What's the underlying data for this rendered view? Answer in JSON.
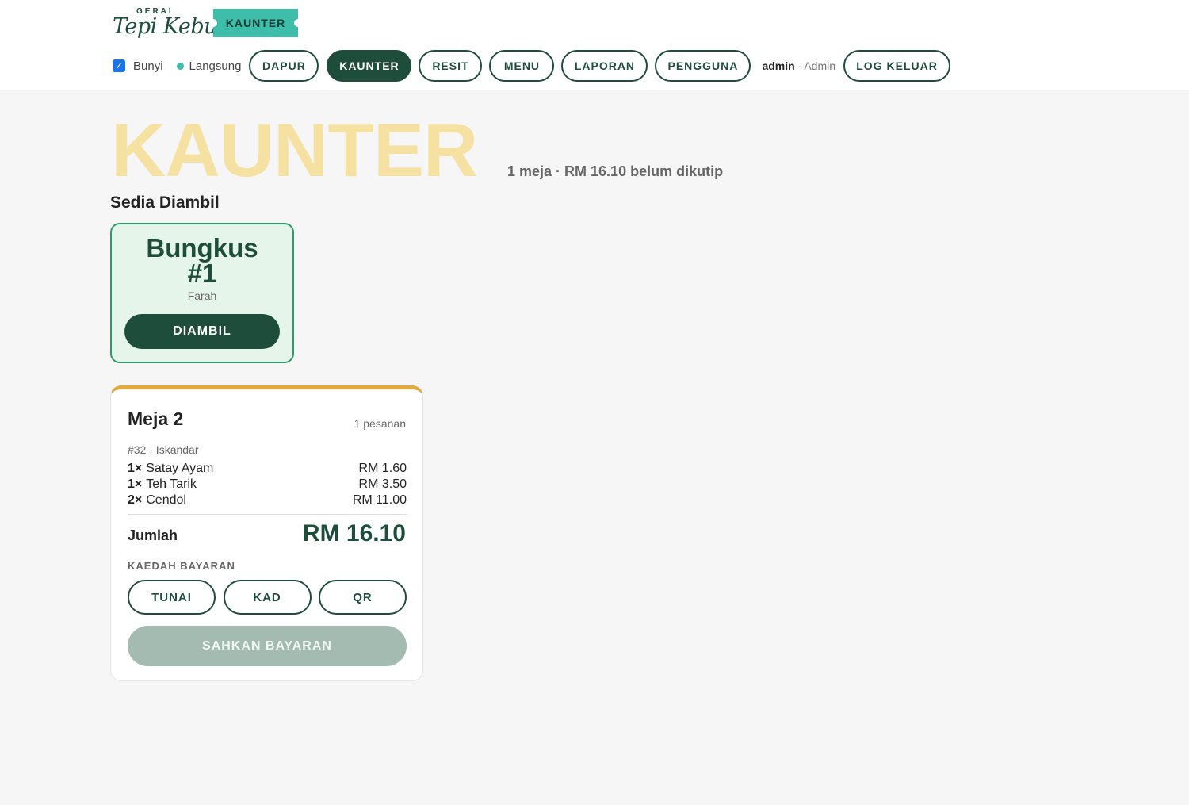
{
  "brand": {
    "small": "GERAI",
    "script": "Tepi Kebun",
    "ticket": "KAUNTER"
  },
  "nav": {
    "sound_label": "Bunyi",
    "sound_checked": true,
    "live_label": "Langsung",
    "buttons": [
      "DAPUR",
      "KAUNTER",
      "RESIT",
      "MENU",
      "LAPORAN",
      "PENGGUNA"
    ],
    "active": "KAUNTER",
    "user_name": "admin",
    "user_sep": " · ",
    "user_role": "Admin",
    "logout": "LOG KELUAR"
  },
  "page": {
    "title": "KAUNTER",
    "subtitle": "1 meja · RM 16.10 belum dikutip",
    "ready_section": "Sedia Diambil"
  },
  "ready_card": {
    "title_line1": "Bungkus",
    "title_line2": "#1",
    "name": "Farah",
    "button": "DIAMBIL"
  },
  "table_card": {
    "table": "Meja 2",
    "order_count": "1 pesanan",
    "order_meta": "#32 · Iskandar",
    "items": [
      {
        "qty": "1×",
        "name": "Satay Ayam",
        "price": "RM 1.60"
      },
      {
        "qty": "1×",
        "name": "Teh Tarik",
        "price": "RM 3.50"
      },
      {
        "qty": "2×",
        "name": "Cendol",
        "price": "RM 11.00"
      }
    ],
    "total_label": "Jumlah",
    "total_value": "RM 16.10",
    "payment_label": "KAEDAH BAYARAN",
    "payment_methods": [
      "TUNAI",
      "KAD",
      "QR"
    ],
    "confirm": "SAHKAN BAYARAN"
  },
  "colors": {
    "primary": "#1f4d3c",
    "accent_teal": "#3dbdaa",
    "title_yellow": "#f5e2a2",
    "card_top_border": "#e2aa3f",
    "ready_border": "#2e9b6c",
    "ready_bg": "#e6f5ea"
  }
}
